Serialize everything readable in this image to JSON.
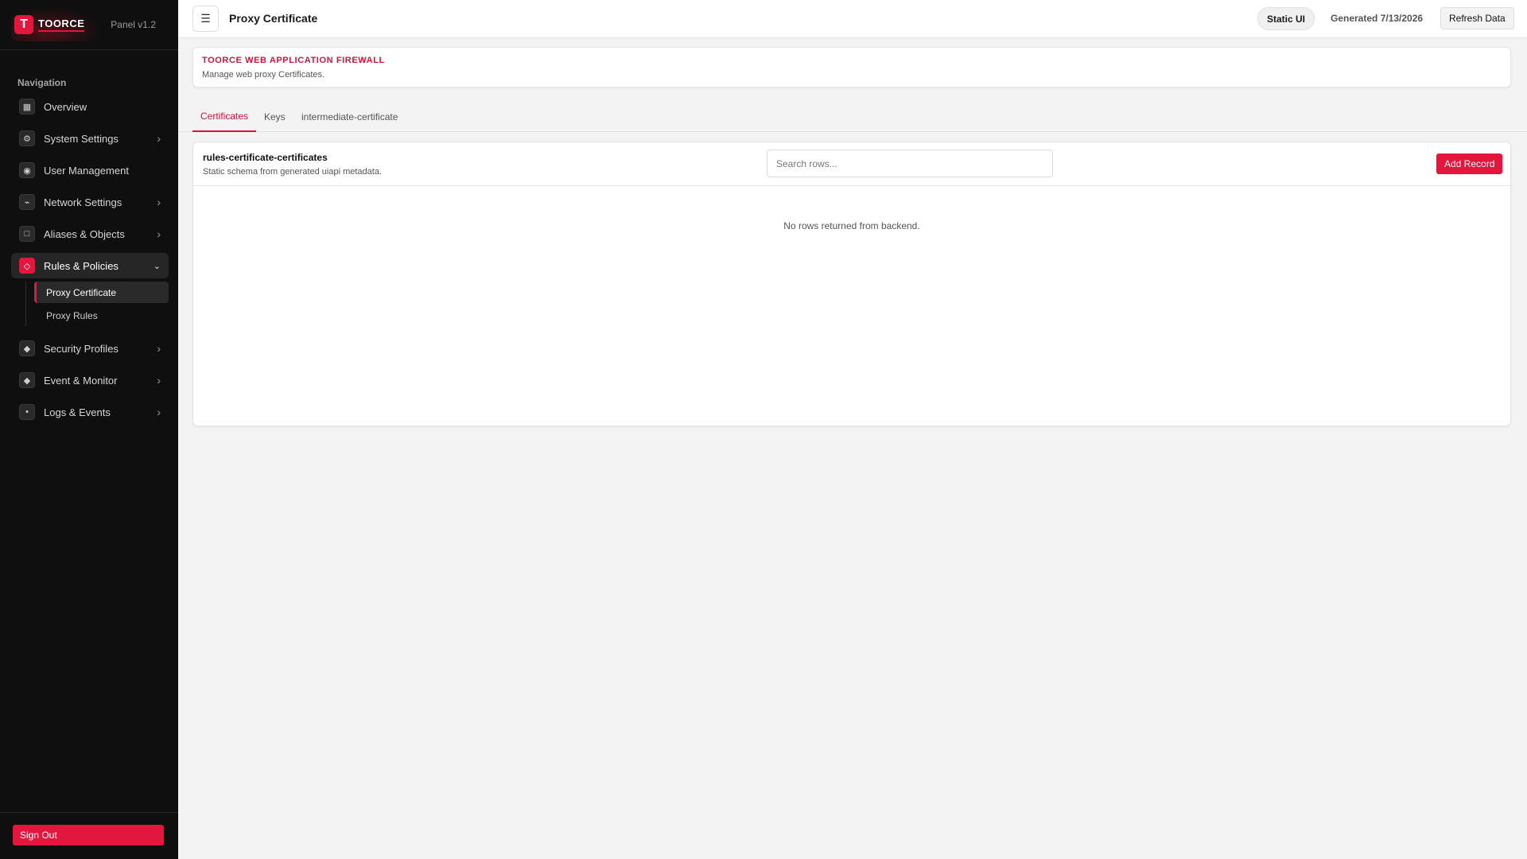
{
  "brand": {
    "logo_letter": "T",
    "name": "TOORCE",
    "version": "Panel v1.2"
  },
  "sidebar": {
    "nav_title": "Navigation",
    "items": [
      {
        "label": "Overview",
        "icon": "grid-icon",
        "glyph": "▦",
        "has_children": false
      },
      {
        "label": "System Settings",
        "icon": "gear-icon",
        "glyph": "⚙",
        "has_children": true
      },
      {
        "label": "User Management",
        "icon": "user-icon",
        "glyph": "◉",
        "has_children": false
      },
      {
        "label": "Network Settings",
        "icon": "network-icon",
        "glyph": "⌁",
        "has_children": true
      },
      {
        "label": "Aliases & Objects",
        "icon": "object-icon",
        "glyph": "□",
        "has_children": true
      },
      {
        "label": "Rules & Policies",
        "icon": "rules-icon",
        "glyph": "◇",
        "has_children": true,
        "expanded": true,
        "children": [
          {
            "label": "Proxy Certificate",
            "active": true
          },
          {
            "label": "Proxy Rules",
            "active": false
          }
        ]
      },
      {
        "label": "Security Profiles",
        "icon": "shield-icon",
        "glyph": "◆",
        "has_children": true
      },
      {
        "label": "Event & Monitor",
        "icon": "monitor-icon",
        "glyph": "◆",
        "has_children": true
      },
      {
        "label": "Logs & Events",
        "icon": "logs-icon",
        "glyph": "•",
        "has_children": true
      }
    ],
    "signout_label": "Sign Out"
  },
  "topbar": {
    "menu_glyph": "☰",
    "title": "Proxy Certificate",
    "static_label": "Static UI",
    "generated": "Generated 7/13/2026",
    "refresh_label": "Refresh Data"
  },
  "banner": {
    "title": "TOORCE WEB APPLICATION FIREWALL",
    "subtitle": "Manage web proxy Certificates."
  },
  "tabs": [
    {
      "label": "Certificates",
      "active": true
    },
    {
      "label": "Keys",
      "active": false
    },
    {
      "label": "intermediate-certificate",
      "active": false
    }
  ],
  "table": {
    "title": "rules-certificate-certificates",
    "subtitle": "Static schema from generated uiapi metadata.",
    "search_placeholder": "Search rows...",
    "add_label": "Add Record",
    "empty_message": "No rows returned from backend."
  },
  "colors": {
    "accent": "#e3173d",
    "sidebar_bg": "#0f0f0f",
    "page_bg": "#f3f3f3"
  }
}
